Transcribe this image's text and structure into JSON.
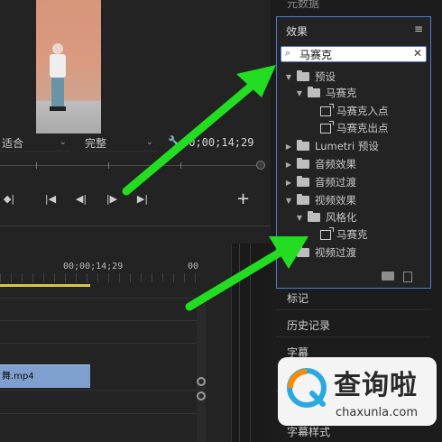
{
  "program_monitor": {
    "fit_label": "适合",
    "quality_label": "完整",
    "timecode": "00;00;14;29",
    "add_button": "+"
  },
  "timeline": {
    "ruler_time_1": "00;00;14;29",
    "ruler_time_2": "00",
    "clip_name": "舞.mp4"
  },
  "panel": {
    "top_label": "元数据",
    "effects": {
      "title": "效果",
      "menu": "≡",
      "search_value": "马赛克",
      "tree": [
        {
          "label": "预设",
          "level": 0,
          "expanded": true,
          "kind": "preset-folder"
        },
        {
          "label": "马赛克",
          "level": 1,
          "expanded": true,
          "kind": "preset-folder"
        },
        {
          "label": "马赛克入点",
          "level": 2,
          "kind": "preset"
        },
        {
          "label": "马赛克出点",
          "level": 2,
          "kind": "preset"
        },
        {
          "label": "Lumetri 预设",
          "level": 0,
          "expanded": false,
          "kind": "folder"
        },
        {
          "label": "音频效果",
          "level": 0,
          "expanded": false,
          "kind": "folder"
        },
        {
          "label": "音频过渡",
          "level": 0,
          "expanded": false,
          "kind": "folder"
        },
        {
          "label": "视频效果",
          "level": 0,
          "expanded": true,
          "kind": "folder"
        },
        {
          "label": "风格化",
          "level": 1,
          "expanded": true,
          "kind": "folder"
        },
        {
          "label": "马赛克",
          "level": 2,
          "kind": "effect"
        },
        {
          "label": "视频过渡",
          "level": 0,
          "expanded": false,
          "kind": "folder"
        }
      ]
    },
    "other_panels": [
      "标记",
      "历史记录",
      "字幕",
      "",
      "字幕样式"
    ]
  },
  "watermark": {
    "text": "查询啦",
    "url": "chaxunla.com"
  },
  "colors": {
    "accent": "#4d7bd2",
    "arrow": "#22dd22",
    "clip": "#7f9fcf"
  }
}
